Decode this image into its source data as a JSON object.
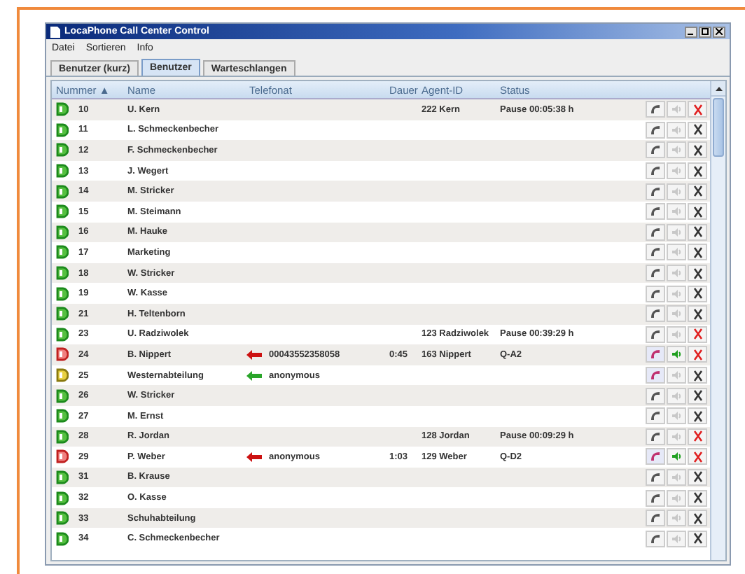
{
  "window": {
    "title": "LocaPhone Call Center Control"
  },
  "menu": [
    "Datei",
    "Sortieren",
    "Info"
  ],
  "tabs": [
    {
      "label": "Benutzer (kurz)",
      "selected": false
    },
    {
      "label": "Benutzer",
      "selected": true
    },
    {
      "label": "Warteschlangen",
      "selected": false
    }
  ],
  "table": {
    "columns": [
      {
        "label": "Nummer",
        "sort": "▲"
      },
      {
        "label": "Name"
      },
      {
        "label": "Telefonat"
      },
      {
        "label": "Dauer"
      },
      {
        "label": "Agent-ID"
      },
      {
        "label": "Status"
      }
    ],
    "rows": [
      {
        "kind": "free",
        "number": "10",
        "name": "U. Kern",
        "agent_id": "222 Kern",
        "status": "Pause 00:05:38 h",
        "phone_active": false,
        "speaker_on": false,
        "hangup_active": true
      },
      {
        "kind": "free",
        "number": "11",
        "name": "L. Schmeckenbecher",
        "phone_active": false,
        "speaker_on": false,
        "hangup_active": false
      },
      {
        "kind": "free",
        "number": "12",
        "name": "F. Schmeckenbecher",
        "phone_active": false,
        "speaker_on": false,
        "hangup_active": false
      },
      {
        "kind": "free",
        "number": "13",
        "name": "J. Wegert",
        "phone_active": false,
        "speaker_on": false,
        "hangup_active": false
      },
      {
        "kind": "free",
        "number": "14",
        "name": "M. Stricker",
        "phone_active": false,
        "speaker_on": false,
        "hangup_active": false
      },
      {
        "kind": "free",
        "number": "15",
        "name": "M. Steimann",
        "phone_active": false,
        "speaker_on": false,
        "hangup_active": false
      },
      {
        "kind": "free",
        "number": "16",
        "name": "M. Hauke",
        "phone_active": false,
        "speaker_on": false,
        "hangup_active": false
      },
      {
        "kind": "free",
        "number": "17",
        "name": "Marketing",
        "phone_active": false,
        "speaker_on": false,
        "hangup_active": false
      },
      {
        "kind": "free",
        "number": "18",
        "name": "W. Stricker",
        "phone_active": false,
        "speaker_on": false,
        "hangup_active": false
      },
      {
        "kind": "free",
        "number": "19",
        "name": "W. Kasse",
        "phone_active": false,
        "speaker_on": false,
        "hangup_active": false
      },
      {
        "kind": "free",
        "number": "21",
        "name": "H. Teltenborn",
        "phone_active": false,
        "speaker_on": false,
        "hangup_active": false
      },
      {
        "kind": "free",
        "number": "23",
        "name": "U. Radziwolek",
        "agent_id": "123 Radziwolek",
        "status": "Pause 00:39:29 h",
        "phone_active": false,
        "speaker_on": false,
        "hangup_active": true
      },
      {
        "kind": "busy",
        "number": "24",
        "name": "B. Nippert",
        "call": {
          "text": "00043552358058",
          "color": "#cc1111"
        },
        "duration": "0:45",
        "agent_id": "163 Nippert",
        "status": "Q-A2",
        "phone_active": true,
        "speaker_on": true,
        "hangup_active": true
      },
      {
        "kind": "ringing",
        "number": "25",
        "name": "Westernabteilung",
        "call": {
          "text": "anonymous",
          "color": "#2aa52a"
        },
        "phone_active": true,
        "speaker_on": false,
        "hangup_active": false
      },
      {
        "kind": "free",
        "number": "26",
        "name": "W. Stricker",
        "phone_active": false,
        "speaker_on": false,
        "hangup_active": false
      },
      {
        "kind": "free",
        "number": "27",
        "name": "M. Ernst",
        "phone_active": false,
        "speaker_on": false,
        "hangup_active": false
      },
      {
        "kind": "free",
        "number": "28",
        "name": "R. Jordan",
        "agent_id": "128 Jordan",
        "status": "Pause 00:09:29 h",
        "phone_active": false,
        "speaker_on": false,
        "hangup_active": true
      },
      {
        "kind": "busy",
        "number": "29",
        "name": "P. Weber",
        "call": {
          "text": "anonymous",
          "color": "#cc1111"
        },
        "duration": "1:03",
        "agent_id": "129 Weber",
        "status": "Q-D2",
        "phone_active": true,
        "speaker_on": true,
        "hangup_active": true
      },
      {
        "kind": "free",
        "number": "31",
        "name": "B. Krause",
        "phone_active": false,
        "speaker_on": false,
        "hangup_active": false
      },
      {
        "kind": "free",
        "number": "32",
        "name": "O. Kasse",
        "phone_active": false,
        "speaker_on": false,
        "hangup_active": false
      },
      {
        "kind": "free",
        "number": "33",
        "name": "Schuhabteilung",
        "phone_active": false,
        "speaker_on": false,
        "hangup_active": false
      },
      {
        "kind": "free",
        "number": "34",
        "name": "C. Schmeckenbecher",
        "phone_active": false,
        "speaker_on": false,
        "hangup_active": false
      }
    ]
  }
}
